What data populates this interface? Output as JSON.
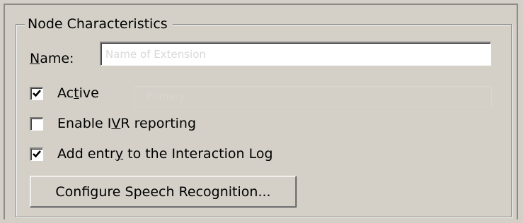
{
  "group": {
    "title": "Node Characteristics"
  },
  "name_field": {
    "label_mnemonic": "N",
    "label_rest": "ame:",
    "value": "",
    "placeholder_hint": "Name of Extension"
  },
  "checkboxes": [
    {
      "label_before": "Ac",
      "label_mnemonic": "t",
      "label_after": "ive",
      "checked": true
    },
    {
      "label_before": "Enable I",
      "label_mnemonic": "V",
      "label_after": "R reporting",
      "checked": false
    },
    {
      "label_before": "Add entr",
      "label_mnemonic": "y",
      "label_after": " to the Interaction Log",
      "checked": true
    }
  ],
  "faint_field": {
    "text": "Primary"
  },
  "configure_button": {
    "label": "Configure Speech Recognition..."
  },
  "colors": {
    "dialog_bg": "#d4d0c8",
    "field_bg": "#ffffff"
  }
}
